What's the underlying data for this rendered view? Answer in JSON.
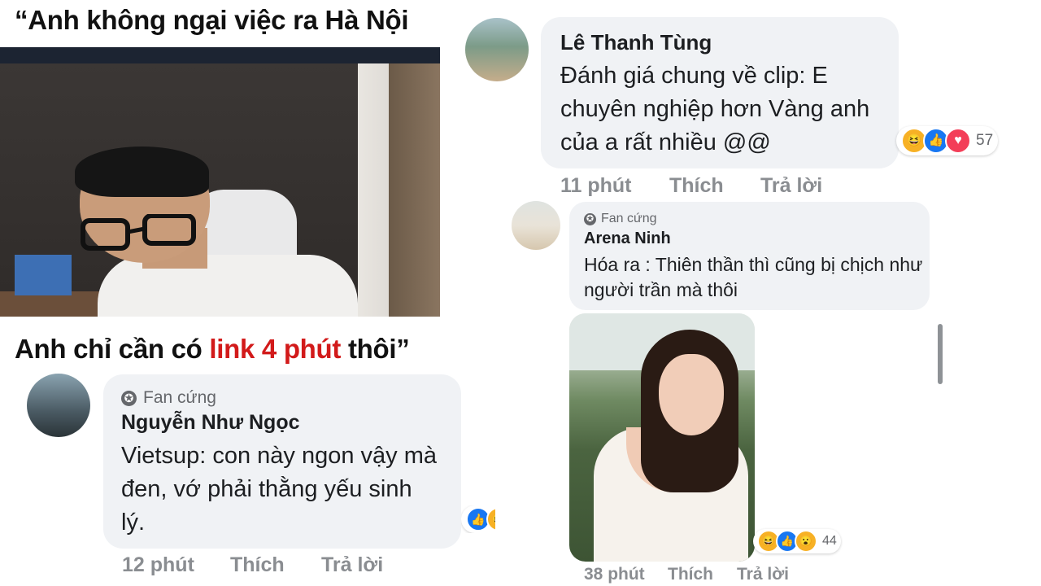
{
  "meme": {
    "headline": "“Anh không ngại việc ra Hà Nội",
    "caption_before": "Anh chỉ cần có ",
    "caption_highlight": "link 4 phút",
    "caption_after": " thôi”"
  },
  "comments": [
    {
      "id": "c1",
      "badge": "Fan cứng",
      "name": "Nguyễn Như Ngọc",
      "text": "Vietsup: con này ngon vậy mà đen, vớ phải thằng yếu sinh lý.",
      "time": "12 phút",
      "like": "Thích",
      "reply": "Trả lời"
    },
    {
      "id": "c2",
      "name": "Lê Thanh Tùng",
      "text": "Đánh giá chung về clip: E chuyên nghiệp hơn Vàng anh của a rất nhiều @@",
      "time": "11 phút",
      "like": "Thích",
      "reply": "Trả lời",
      "reaction_count": "57"
    },
    {
      "id": "c3",
      "badge": "Fan cứng",
      "name": "Arena Ninh",
      "text": "Hóa ra : Thiên thần thì cũng bị chịch như người trần mà thôi",
      "time": "38 phút",
      "like": "Thích",
      "reply": "Trả lời",
      "reaction_count": "44"
    }
  ],
  "icons": {
    "haha": "😆",
    "like": "👍",
    "love": "♥",
    "wow": "😮",
    "star": "✪"
  },
  "colors": {
    "bubble": "#f0f2f5",
    "like_blue": "#1877f2",
    "love_red": "#f33e58",
    "haha_yellow": "#f7b125",
    "caption_red": "#d21a1a"
  }
}
